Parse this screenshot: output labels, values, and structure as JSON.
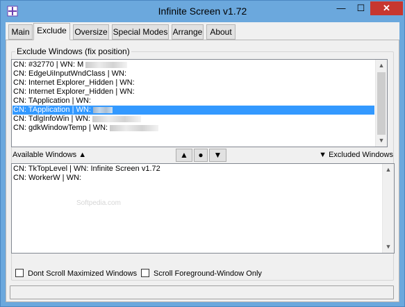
{
  "window": {
    "title": "Infinite Screen v1.72",
    "controls": {
      "minimize": "—",
      "maximize": "☐",
      "close": "✕"
    }
  },
  "tabs": [
    {
      "label": "Main"
    },
    {
      "label": "Exclude"
    },
    {
      "label": "Oversize"
    },
    {
      "label": "Special Modes"
    },
    {
      "label": "Arrange"
    },
    {
      "label": "About"
    }
  ],
  "active_tab": "Exclude",
  "group": {
    "label": "Exclude Windows (fix position)"
  },
  "excluded_list": {
    "items": [
      {
        "text": "CN: #32770 | WN: M"
      },
      {
        "text": "CN: EdgeUiInputWndClass | WN:"
      },
      {
        "text": "CN: Internet Explorer_Hidden | WN:"
      },
      {
        "text": "CN: Internet Explorer_Hidden | WN:"
      },
      {
        "text": "CN: TApplication | WN:"
      },
      {
        "text": "CN: TApplication | WN:",
        "selected": true
      },
      {
        "text": "CN: TdlgInfoWin | WN:"
      },
      {
        "text": "CN: gdkWindowTemp | WN:"
      }
    ]
  },
  "middle": {
    "available_label": "Available Windows",
    "excluded_label": "Excluded Windows",
    "up_icon": "▲",
    "down_icon": "▼",
    "move_up": "▲",
    "dot": "●",
    "move_down": "▼"
  },
  "available_list": {
    "items": [
      {
        "text": "CN: TkTopLevel | WN: Infinite Screen v1.72"
      },
      {
        "text": "CN: WorkerW | WN:"
      }
    ]
  },
  "options": {
    "dont_scroll_maximized": "Dont Scroll Maximized Windows",
    "scroll_foreground_only": "Scroll Foreground-Window Only"
  },
  "watermark": "Softpedia.com",
  "colors": {
    "selection": "#3399ff",
    "titlebar": "#6ba8dd",
    "close": "#c7372f"
  }
}
